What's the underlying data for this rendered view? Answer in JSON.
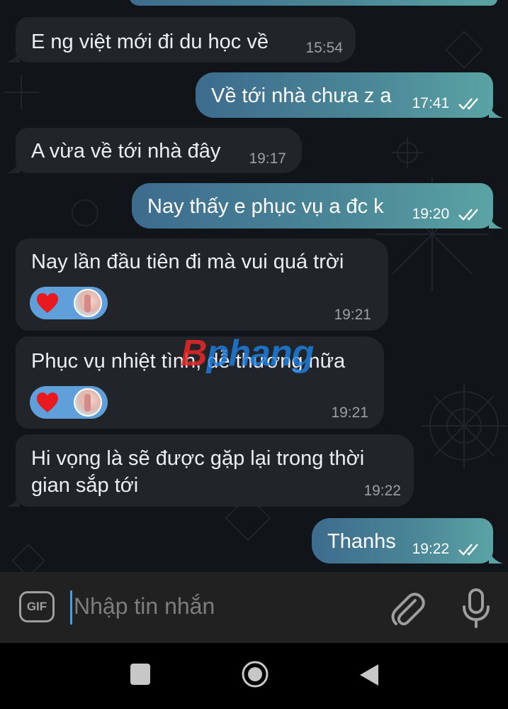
{
  "watermark": {
    "text": "Bphang"
  },
  "messages": [
    {
      "dir": "in",
      "text": "E ng việt mới đi du học về",
      "time": "15:54"
    },
    {
      "dir": "out",
      "text": "Về tới nhà chưa z a",
      "time": "17:41",
      "status": "read"
    },
    {
      "dir": "in",
      "text": "A vừa về tới nhà đây",
      "time": "19:17"
    },
    {
      "dir": "out",
      "text": "Nay thấy e phục vụ a đc k",
      "time": "19:20",
      "status": "read"
    },
    {
      "dir": "in",
      "text": "Nay lần đầu tiên đi mà vui quá trời",
      "time": "19:21",
      "reactions": [
        "heart-icon",
        "user-avatar"
      ]
    },
    {
      "dir": "in",
      "text": "Phục vụ nhiệt tình, dễ thương nữa",
      "time": "19:21",
      "reactions": [
        "heart-icon",
        "user-avatar"
      ]
    },
    {
      "dir": "in",
      "text_line1": "Hi vọng là sẽ được gặp lại trong thời",
      "text_line2": "gian sắp tới",
      "time": "19:22"
    },
    {
      "dir": "out",
      "text": "Thanhs",
      "time": "19:22",
      "status": "read"
    }
  ],
  "input": {
    "placeholder": "Nhập tin nhắn",
    "gif_label": "GIF"
  },
  "icons": {
    "gif": "gif-icon",
    "attach": "paperclip-icon",
    "voice": "microphone-icon",
    "nav": [
      "recents-square-icon",
      "home-circle-icon",
      "back-triangle-icon"
    ]
  },
  "colors": {
    "incoming_bubble": "#212529",
    "outgoing_bubble_start": "#3d6c8e",
    "outgoing_bubble_end": "#5aa3a4",
    "reaction_pill": "#5f9fda",
    "background": "#111418",
    "cursor": "#3ba3ef"
  }
}
